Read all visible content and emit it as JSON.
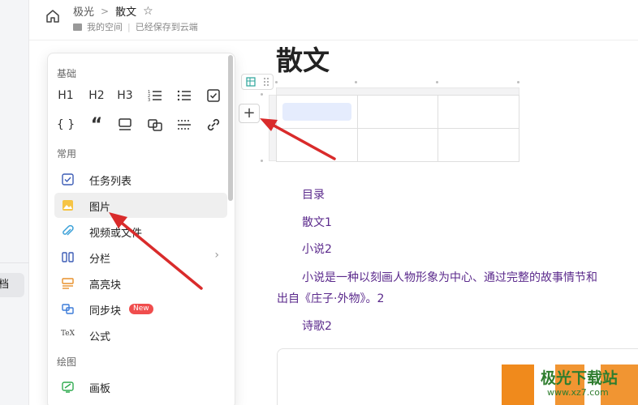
{
  "sidebar": {
    "selected_label": "档"
  },
  "header": {
    "breadcrumb": [
      "极光",
      "散文"
    ],
    "space_label": "我的空间",
    "save_status": "已经保存到云端"
  },
  "document": {
    "title": "散文",
    "paragraphs": [
      {
        "text": "目录"
      },
      {
        "text": "散文1"
      },
      {
        "text": "小说2"
      },
      {
        "text": "小说是一种以刻画人物形象为中心、通过完整的故事情节和"
      },
      {
        "text": "出自《庄子·外物》。2"
      },
      {
        "text": "诗歌2"
      }
    ],
    "add_button": "+"
  },
  "menu": {
    "sections": {
      "basic": "基础",
      "common": "常用",
      "drawing": "绘图"
    },
    "format_row1": [
      "H1",
      "H2",
      "H3"
    ],
    "format_row2": [
      "{ }",
      "“"
    ],
    "items": [
      {
        "label": "任务列表",
        "icon": "task-list-icon"
      },
      {
        "label": "图片",
        "icon": "image-icon"
      },
      {
        "label": "视频或文件",
        "icon": "attachment-icon"
      },
      {
        "label": "分栏",
        "icon": "columns-icon"
      },
      {
        "label": "高亮块",
        "icon": "highlight-block-icon"
      },
      {
        "label": "同步块",
        "icon": "sync-block-icon",
        "badge": "New"
      },
      {
        "label": "公式",
        "icon": "formula-icon"
      },
      {
        "label": "画板",
        "icon": "whiteboard-icon"
      }
    ]
  },
  "watermark": {
    "text": "极光下载站",
    "url": "www.xz7.com"
  },
  "colors": {
    "accent": "#5b2a8c",
    "arrow": "#d92b2b",
    "badge": "#f04d4d"
  }
}
